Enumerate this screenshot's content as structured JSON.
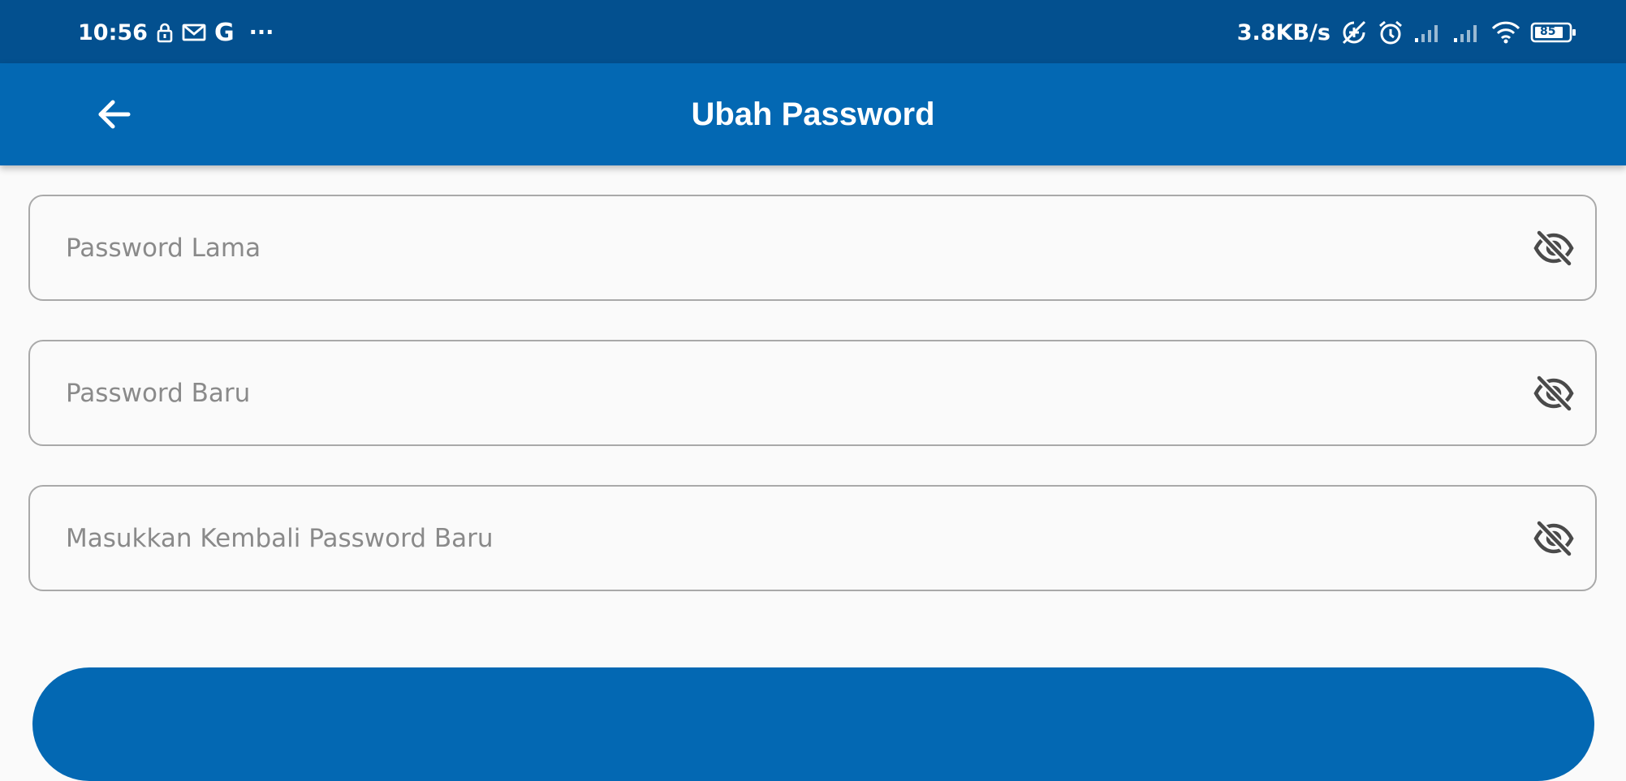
{
  "status_bar": {
    "time": "10:56",
    "g_label": "G",
    "more_label": "···",
    "network_speed": "3.8KB/s",
    "battery_level": "85"
  },
  "header": {
    "title": "Ubah Password"
  },
  "form": {
    "old_password_placeholder": "Password Lama",
    "new_password_placeholder": "Password Baru",
    "confirm_password_placeholder": "Masukkan Kembali Password Baru"
  },
  "colors": {
    "status_bar": "#03508f",
    "app_bar": "#0368b3",
    "background": "#fafafa",
    "field_border": "#a9a9a9",
    "icon": "#4a4a4a"
  },
  "icons": {
    "back": "arrow-left-icon",
    "password_toggle": "eye-off-icon"
  }
}
